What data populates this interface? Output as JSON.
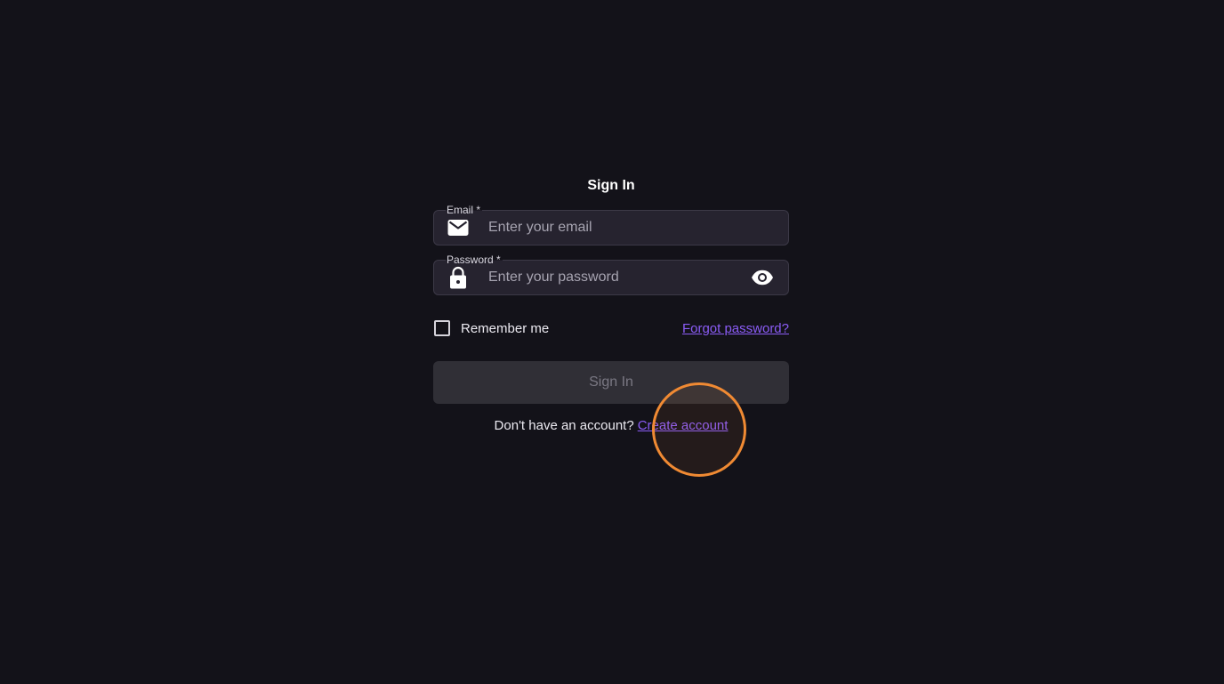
{
  "signin": {
    "title": "Sign In",
    "email": {
      "label": "Email *",
      "placeholder": "Enter your email",
      "value": "",
      "icon": "mail-icon"
    },
    "password": {
      "label": "Password *",
      "placeholder": "Enter your password",
      "value": "",
      "icon": "lock-icon",
      "toggle_icon": "eye-icon"
    },
    "remember_me": {
      "label": "Remember me",
      "checked": false
    },
    "forgot_password_label": "Forgot password?",
    "submit_label": "Sign In",
    "signup_prompt": "Don't have an account?",
    "create_account_label": "Create account"
  },
  "colors": {
    "background": "#131219",
    "accent": "#8b5cf6",
    "field_bg": "#26232f",
    "button_disabled_bg": "#302f36",
    "cursor_highlight": "#f08a33"
  }
}
